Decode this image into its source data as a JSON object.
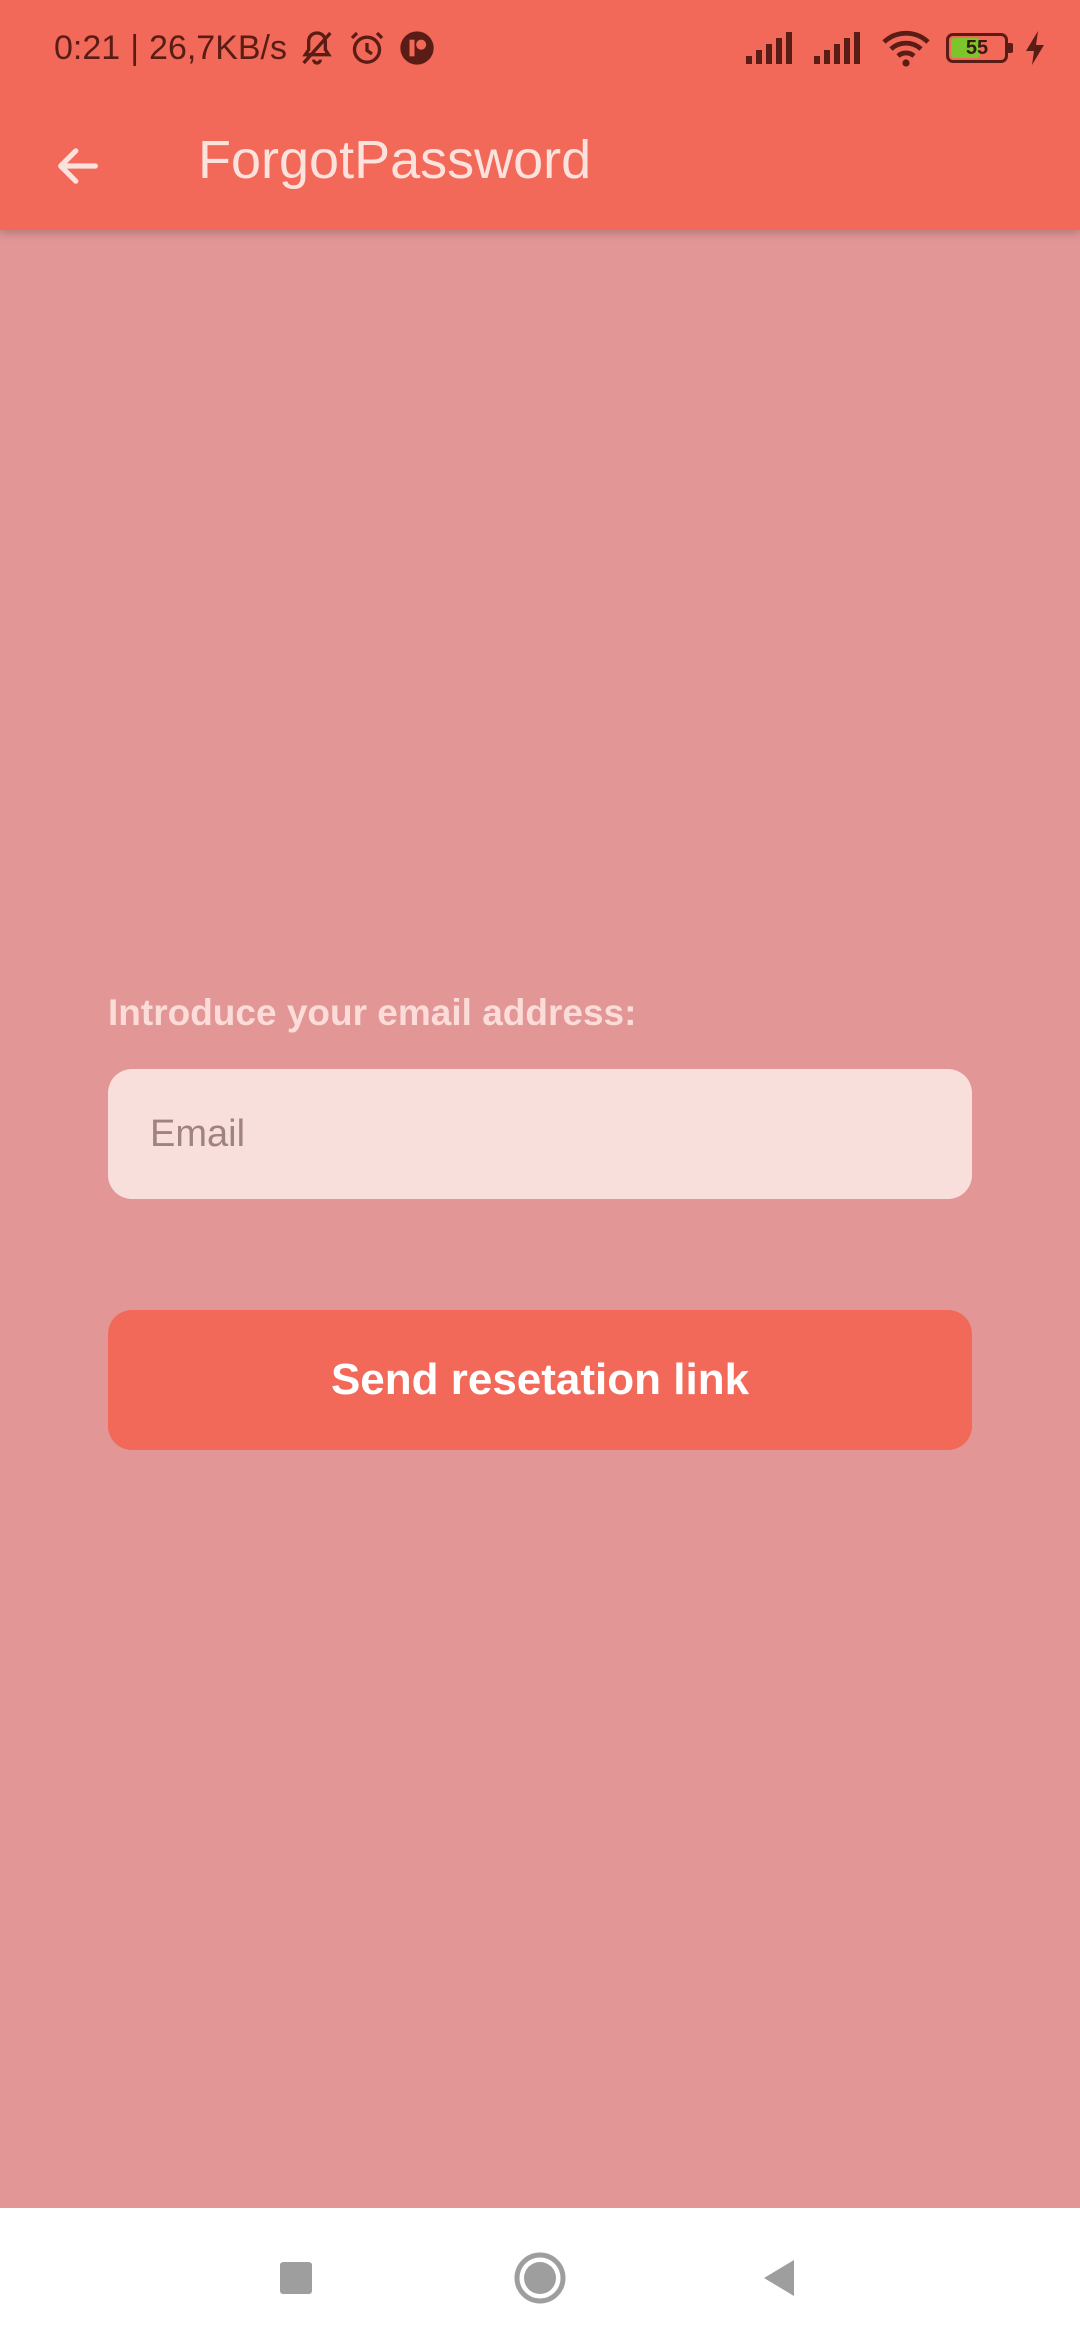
{
  "status_bar": {
    "time": "0:21",
    "separator": "|",
    "speed": "26,7KB/s",
    "battery_level": "55",
    "battery_fraction": 0.55,
    "icons": [
      "bell-muted-icon",
      "alarm-icon",
      "app-notification-icon",
      "signal-icon",
      "signal-icon",
      "wifi-icon",
      "battery-icon",
      "charging-icon"
    ]
  },
  "app_bar": {
    "title": "ForgotPassword",
    "back_icon": "arrow-left-icon"
  },
  "form": {
    "label": "Introduce your email address:",
    "email_placeholder": "Email",
    "email_value": "",
    "submit_label": "Send resetation link"
  },
  "nav_bar": {
    "buttons": [
      "recents-square-icon",
      "home-circle-icon",
      "back-triangle-icon"
    ]
  },
  "colors": {
    "primary": "#f26859",
    "background": "#e29695",
    "input_background": "#f9dfdc",
    "title_text": "#fbe2dc"
  }
}
